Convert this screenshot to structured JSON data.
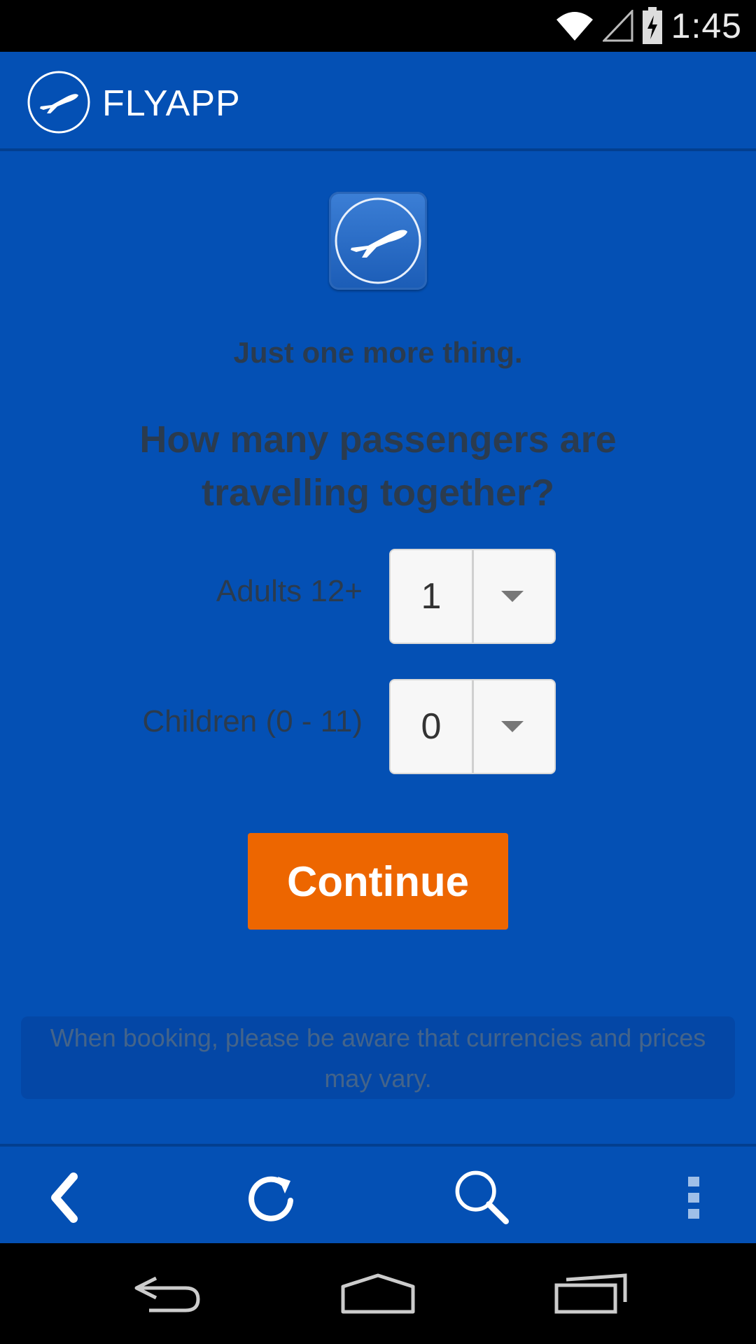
{
  "status_bar": {
    "time": "1:45",
    "icons": [
      "wifi-icon",
      "cell-signal-icon",
      "battery-charging-icon"
    ]
  },
  "app_bar": {
    "title": "FLYAPP",
    "logo_icon": "airplane-logo-icon"
  },
  "main": {
    "subtitle": "Just one more thing.",
    "question": "How many passengers are travelling together?",
    "adults": {
      "label": "Adults 12+",
      "value": "1"
    },
    "children": {
      "label": "Children (0 - 11)",
      "value": "0"
    },
    "continue_label": "Continue",
    "notice": "When booking, please be aware that currencies and prices may vary."
  },
  "browser_bar": {
    "icons": [
      "back-arrow-icon",
      "refresh-icon",
      "search-icon",
      "overflow-menu-icon"
    ]
  },
  "system_nav": {
    "icons": [
      "system-back-icon",
      "system-home-icon",
      "system-recents-icon"
    ]
  },
  "colors": {
    "background": "#0450B4",
    "accent": "#ED6600",
    "text_dark": "#2b3b4e"
  }
}
